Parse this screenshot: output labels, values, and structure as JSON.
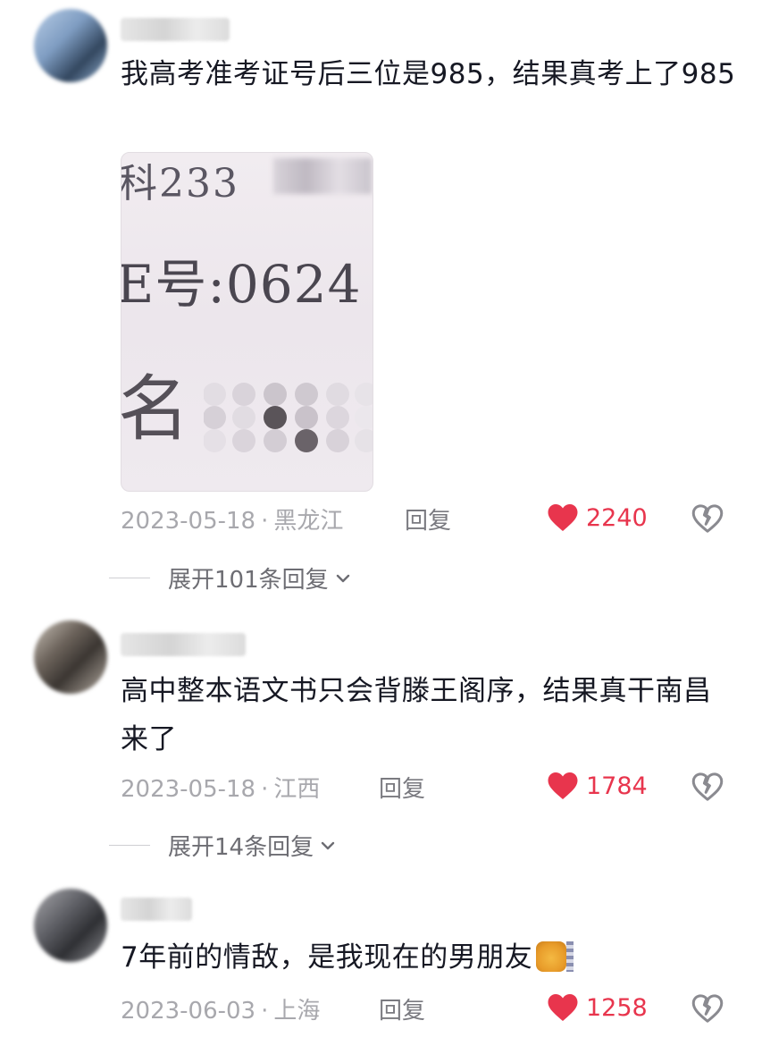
{
  "colors": {
    "like": "#e8354d",
    "meta": "#a8a8ad",
    "text": "#161823"
  },
  "comments": [
    {
      "username": "██████",
      "text": "我高考准考证号后三位是985，结果真考上了985",
      "image": {
        "line1": "科233",
        "line2": "E号:0624",
        "line3": "名"
      },
      "date": "2023-05-18",
      "location": "黑龙江",
      "reply": "回复",
      "likes": "2240",
      "expand": "展开101条回复"
    },
    {
      "username": "████ ███",
      "text": "高中整本语文书只会背滕王阁序，结果真干南昌来了",
      "date": "2023-05-18",
      "location": "江西",
      "reply": "回复",
      "likes": "1784",
      "expand": "展开14条回复"
    },
    {
      "username": "██████",
      "text": "7年前的情敌，是我现在的男朋友",
      "emoji": "cat-face-emoji",
      "date": "2023-06-03",
      "location": "上海",
      "reply": "回复",
      "likes": "1258"
    }
  ],
  "separator": "·"
}
